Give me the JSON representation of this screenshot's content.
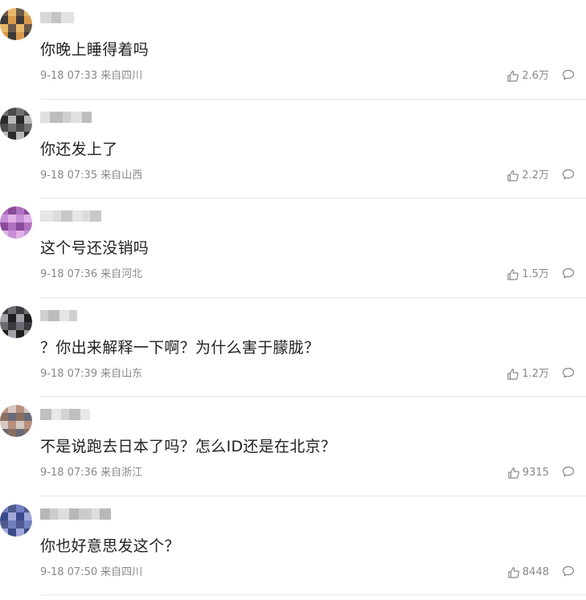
{
  "icons": {
    "like": "thumbs-up-icon",
    "reply": "comment-bubble-icon"
  },
  "colors": {
    "meta_text": "#888888",
    "content_text": "#222222",
    "divider": "#e8e8e8"
  },
  "comments": [
    {
      "text": "你晚上睡得着吗",
      "date": "9-18 07:33",
      "location": "来自四川",
      "likes": "2.6万",
      "avatar_palette": [
        "#6b5a4a",
        "#d89a4a",
        "#e8b86a",
        "#3e3a38"
      ],
      "name_palette": [
        "#d8d8d8",
        "#c4c4c4",
        "#e2e2e2"
      ]
    },
    {
      "text": "你还发上了",
      "date": "9-18 07:35",
      "location": "来自山西",
      "likes": "2.2万",
      "avatar_palette": [
        "#2a2a2a",
        "#707070",
        "#b8b8b8",
        "#4a4a4a"
      ],
      "name_palette": [
        "#cfcfcf",
        "#e0e0e0",
        "#bdbdbd"
      ]
    },
    {
      "text": "这个号还没销吗",
      "date": "9-18 07:36",
      "location": "来自河北",
      "likes": "1.5万",
      "avatar_palette": [
        "#8a4a9a",
        "#c890d8",
        "#b070c0",
        "#e0b0e8"
      ],
      "name_palette": [
        "#dcdcdc",
        "#c8c8c8",
        "#e6e6e6"
      ]
    },
    {
      "text": "？你出来解释一下啊？为什么害于朦胧？",
      "date": "9-18 07:39",
      "location": "来自山东",
      "likes": "1.2万",
      "avatar_palette": [
        "#1e1e1e",
        "#6a6a70",
        "#a0a0a8",
        "#3a3a40"
      ],
      "name_palette": [
        "#d0d0d0",
        "#bcbcbc",
        "#e4e4e4"
      ]
    },
    {
      "text": "不是说跑去日本了吗？怎么ID还是在北京？",
      "date": "9-18 07:36",
      "location": "来自浙江",
      "likes": "9315",
      "avatar_palette": [
        "#b89080",
        "#6a6a78",
        "#d8c8c0",
        "#8a7060"
      ],
      "name_palette": [
        "#d4d4d4",
        "#c0c0c0",
        "#e8e8e8"
      ]
    },
    {
      "text": "你也好意思发这个？",
      "date": "9-18 07:50",
      "location": "来自四川",
      "likes": "8448",
      "avatar_palette": [
        "#3a4a8a",
        "#7080c0",
        "#a0a8d8",
        "#505a90"
      ],
      "name_palette": [
        "#cccccc",
        "#dedede",
        "#b8b8b8"
      ]
    }
  ]
}
